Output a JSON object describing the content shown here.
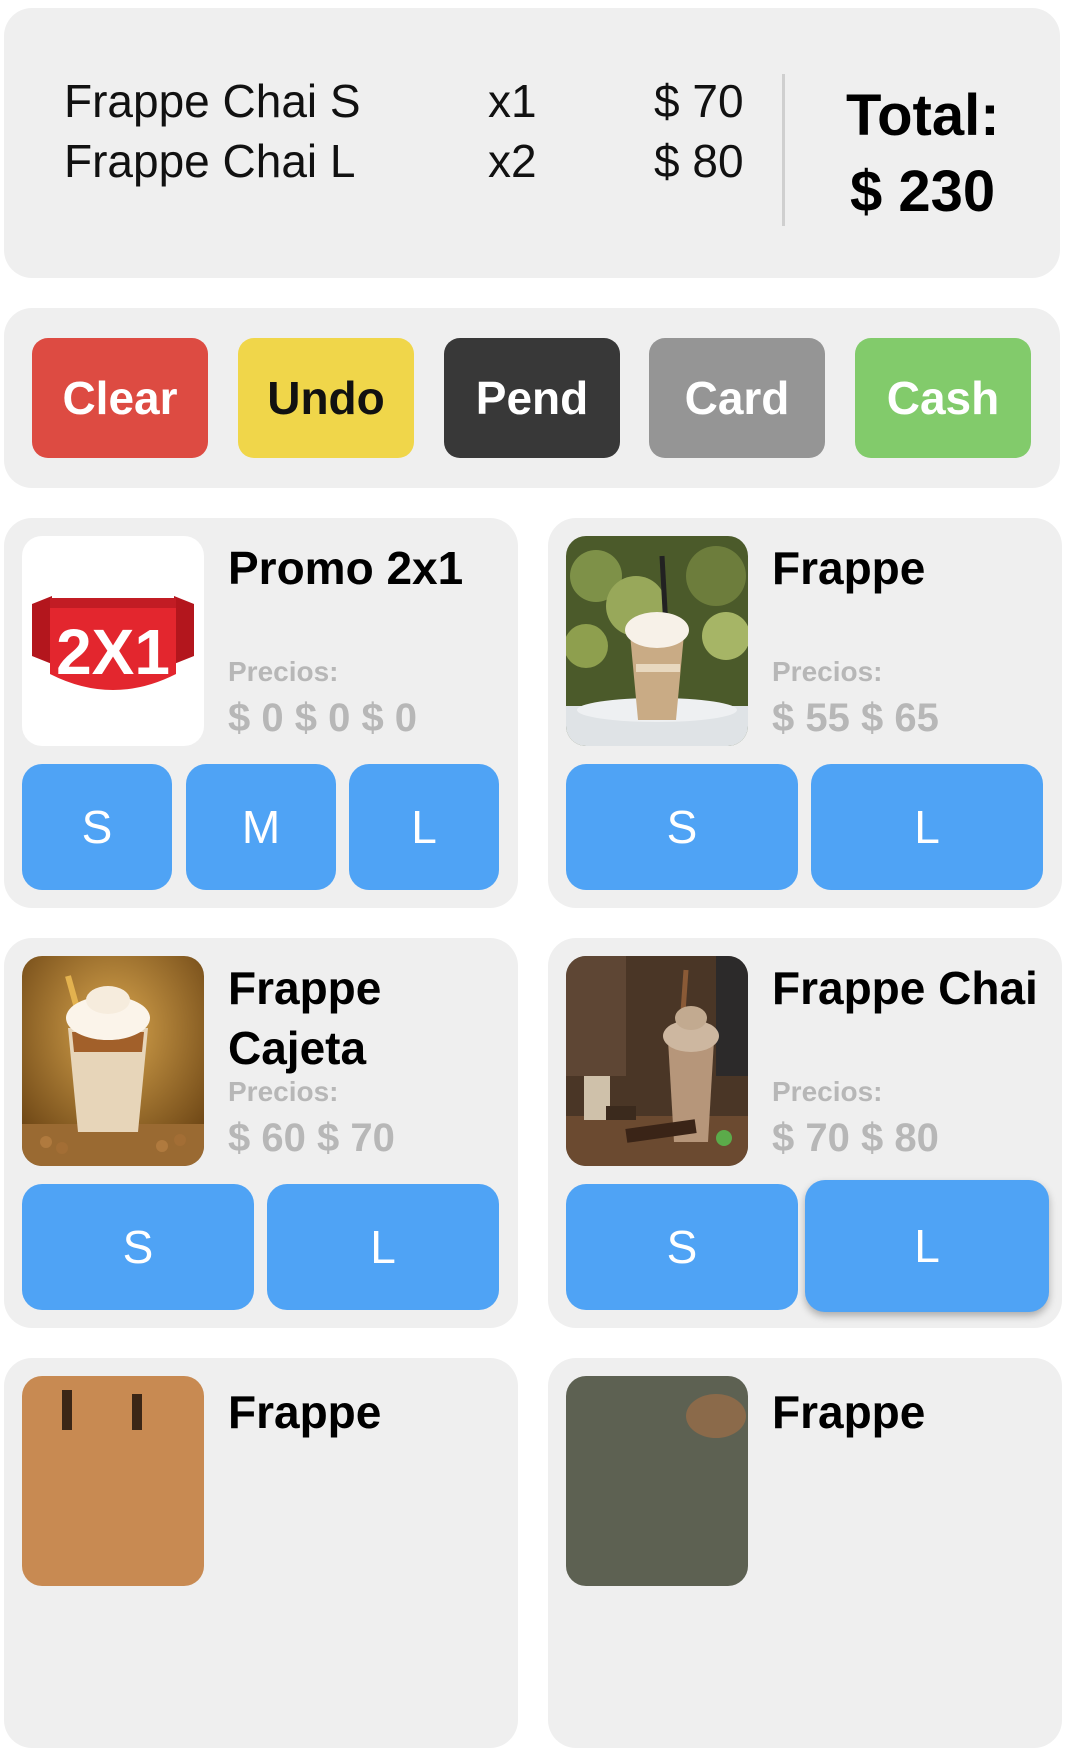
{
  "order": {
    "lines": [
      {
        "name": "Frappe Chai S",
        "qty": "x1",
        "price": "$ 70"
      },
      {
        "name": "Frappe Chai L",
        "qty": "x2",
        "price": "$ 80"
      }
    ],
    "total_label": "Total:",
    "total_value": "$ 230"
  },
  "actions": [
    {
      "label": "Clear",
      "color": "#dd4b42",
      "text_color": "#ffffff"
    },
    {
      "label": "Undo",
      "color": "#f0d64a",
      "text_color": "#111111"
    },
    {
      "label": "Pend",
      "color": "#383838",
      "text_color": "#ffffff"
    },
    {
      "label": "Card",
      "color": "#959595",
      "text_color": "#ffffff"
    },
    {
      "label": "Cash",
      "color": "#82cb6b",
      "text_color": "#ffffff"
    }
  ],
  "products": [
    {
      "name": "Promo 2x1",
      "prices_label": "Precios:",
      "prices": "$ 0 $ 0 $ 0",
      "sizes": [
        "S",
        "M",
        "L"
      ],
      "badge": "2X1"
    },
    {
      "name": "Frappe",
      "prices_label": "Precios:",
      "prices": "$ 55 $ 65",
      "sizes": [
        "S",
        "L"
      ]
    },
    {
      "name": "Frappe Cajeta",
      "prices_label": "Precios:",
      "prices": "$ 60 $ 70",
      "sizes": [
        "S",
        "L"
      ]
    },
    {
      "name": "Frappe Chai",
      "prices_label": "Precios:",
      "prices": "$ 70 $ 80",
      "sizes": [
        "S",
        "L"
      ]
    },
    {
      "name": "Frappe"
    },
    {
      "name": "Frappe"
    }
  ]
}
